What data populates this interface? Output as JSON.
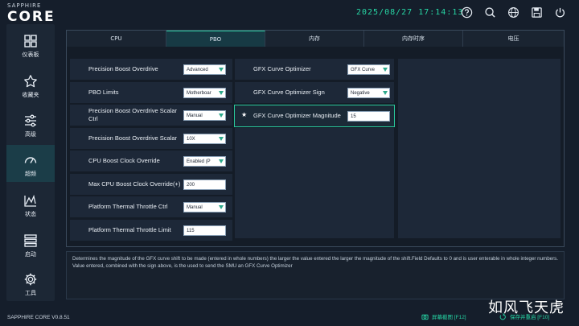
{
  "app": {
    "logo_sub": "SAPPHIRE",
    "logo_main": "CORE",
    "datetime": "2025/08/27 17:14:13",
    "version": "SAPPHIRE CORE V0.8.51",
    "watermark": "如风飞天虎",
    "accent_color": "#27d6a4"
  },
  "toolbar": {
    "icons": [
      "help-icon",
      "search-icon",
      "globe-icon",
      "save-icon",
      "power-icon"
    ]
  },
  "sidebar": {
    "items": [
      {
        "label": "仪表板",
        "icon": "dashboard-icon"
      },
      {
        "label": "收藏夹",
        "icon": "star-icon"
      },
      {
        "label": "高级",
        "icon": "sliders-icon"
      },
      {
        "label": "超频",
        "icon": "gauge-icon"
      },
      {
        "label": "状态",
        "icon": "chart-icon"
      },
      {
        "label": "启动",
        "icon": "boot-icon"
      },
      {
        "label": "工具",
        "icon": "gear-icon"
      }
    ],
    "active_index": 3
  },
  "tabs": [
    "CPU",
    "PBO",
    "内存",
    "内存时序",
    "电压"
  ],
  "active_tab": 1,
  "left_settings": [
    {
      "name": "Precision Boost Overdrive",
      "type": "select",
      "value": "Advanced"
    },
    {
      "name": "PBO Limits",
      "type": "select",
      "value": "Motherboar"
    },
    {
      "name": "Precision Boost Overdrive Scalar Ctrl",
      "type": "select",
      "value": "Manual"
    },
    {
      "name": "Precision Boost Overdrive Scalar",
      "type": "select",
      "value": "10X"
    },
    {
      "name": "CPU Boost Clock Override",
      "type": "select",
      "value": "Enabled (P"
    },
    {
      "name": "Max CPU Boost Clock Override(+)",
      "type": "input",
      "value": "200"
    },
    {
      "name": "Platform Thermal Throttle Ctrl",
      "type": "select",
      "value": "Manual"
    },
    {
      "name": "Platform Thermal Throttle Limit",
      "type": "input",
      "value": "115"
    }
  ],
  "right_settings": [
    {
      "name": "GFX Curve Optimizer",
      "type": "select",
      "value": "GFX Curve"
    },
    {
      "name": "GFX Curve Optimizer Sign",
      "type": "select",
      "value": "Negative"
    },
    {
      "name": "GFX Curve Optimizer Magnitude",
      "type": "input",
      "value": "15",
      "favorite": true
    }
  ],
  "description": "Determines the magnitude of the GFX curve shift to be made (entered in whole numbers) the larger the value entered the larger the magnitude of the shift.Field Defaults to 0 and is user enterable in whole integer numbers. Value entered, combined with the sign above, is the used to send the SMU an GFX Curve Optimizer",
  "bottom": {
    "screenshot_label": "屏幕截图 [F12]",
    "save_label": "保存并重启 [F10]"
  }
}
